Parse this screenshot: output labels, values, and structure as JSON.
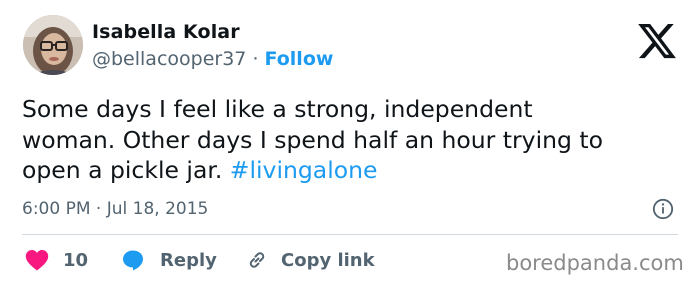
{
  "author": {
    "name": "Isabella Kolar",
    "handle": "@bellacooper37",
    "separator": "·",
    "follow_label": "Follow"
  },
  "tweet": {
    "text_plain": "Some days I feel like a strong, independent\nwoman.  Other days I spend half an hour trying to\nopen a pickle jar. ",
    "hashtag": "#livingalone",
    "timestamp": "6:00 PM · Jul 18, 2015"
  },
  "actions": {
    "like_count": "10",
    "reply_label": "Reply",
    "copy_link_label": "Copy link"
  },
  "icons": {
    "brand": "x-logo",
    "info": "info-icon",
    "like": "heart-icon",
    "reply": "reply-bubble-icon",
    "copy_link": "link-icon"
  },
  "colors": {
    "accent": "#1d9bf0",
    "like": "#f91880",
    "text": "#0f1419",
    "muted": "#536471"
  },
  "watermark": "boredpanda.com"
}
